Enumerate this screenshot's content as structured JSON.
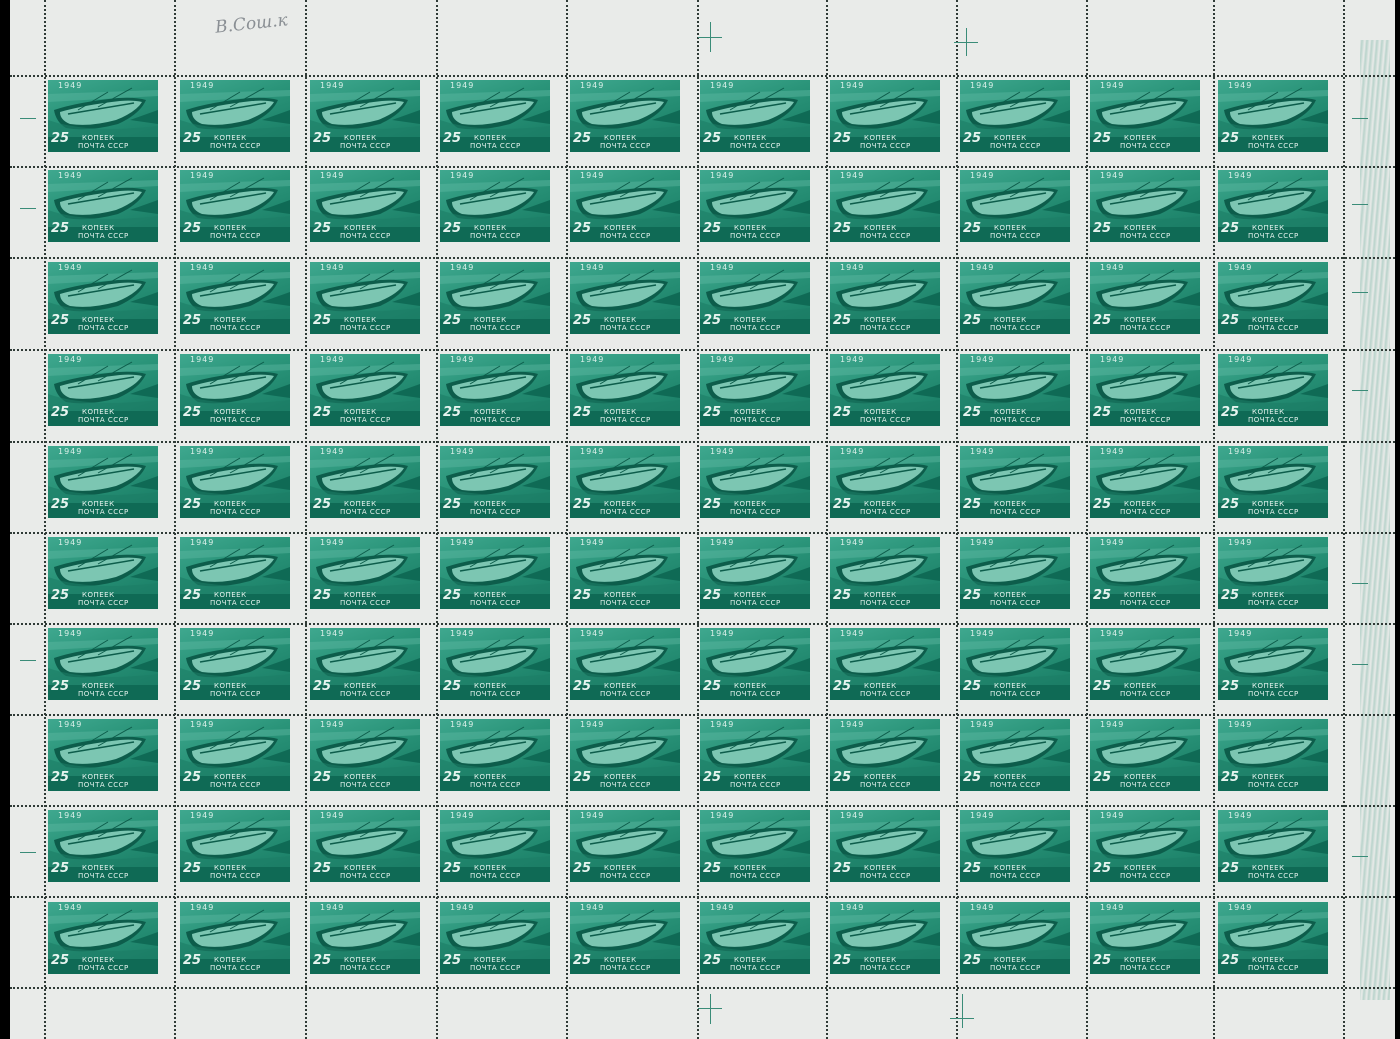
{
  "sheet": {
    "rows": 10,
    "cols": 10,
    "stamp_color": "#1e8a72",
    "margin_color": "#e9ebe9"
  },
  "stamp": {
    "year": "1949",
    "value": "25",
    "currency": "КОПЕЕК",
    "country": "ПОЧТА СССР",
    "subject": "motor-boat-icon"
  },
  "margin_note": "В.Сош.к"
}
